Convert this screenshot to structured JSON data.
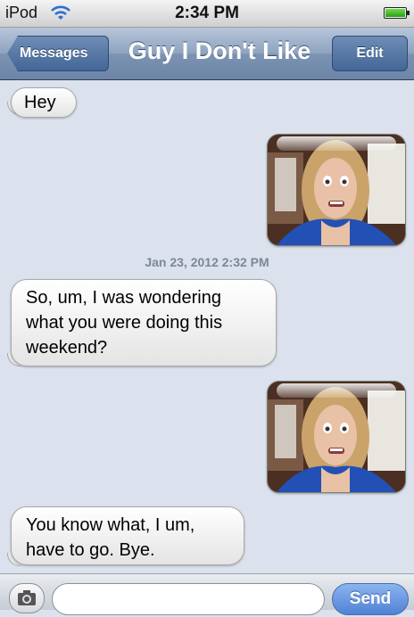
{
  "status_bar": {
    "carrier": "iPod",
    "time": "2:34 PM"
  },
  "nav": {
    "back_label": "Messages",
    "title": "Guy I Don't Like",
    "edit_label": "Edit"
  },
  "messages": [
    {
      "text": "Hey"
    },
    {
      "text": "So, um, I was wondering what you were doing this weekend?"
    },
    {
      "text": "You know what, I um, have to go. Bye."
    }
  ],
  "timestamp": "Jan 23, 2012 2:32 PM",
  "composer": {
    "placeholder": "",
    "send_label": "Send"
  },
  "icons": {
    "wifi": "wifi-icon",
    "battery": "battery-icon",
    "camera": "camera-icon"
  },
  "colors": {
    "nav_bar": "#8ea3bf",
    "background": "#dbe2ed",
    "send_button": "#4f82d6"
  }
}
